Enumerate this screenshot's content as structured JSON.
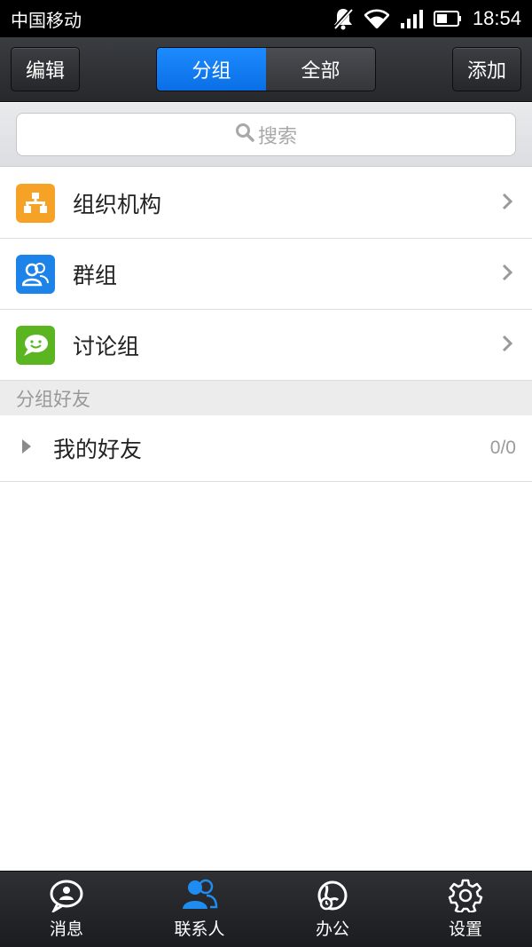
{
  "status_bar": {
    "carrier": "中国移动",
    "time": "18:54",
    "icons": [
      "notification-muted-icon",
      "wifi-icon",
      "signal-icon",
      "battery-icon"
    ]
  },
  "title_bar": {
    "edit_label": "编辑",
    "add_label": "添加",
    "tabs": [
      {
        "label": "分组",
        "active": true
      },
      {
        "label": "全部",
        "active": false
      }
    ]
  },
  "search": {
    "placeholder": "搜索"
  },
  "list": [
    {
      "label": "组织机构",
      "icon": "org-chart-icon",
      "color": "#f6a227"
    },
    {
      "label": "群组",
      "icon": "group-icon",
      "color": "#1e83e8"
    },
    {
      "label": "讨论组",
      "icon": "chat-bubble-icon",
      "color": "#5bb520"
    }
  ],
  "section": {
    "title": "分组好友"
  },
  "friends_group": {
    "label": "我的好友",
    "count": "0/0"
  },
  "bottom_nav": [
    {
      "label": "消息",
      "icon": "message-icon",
      "active": false
    },
    {
      "label": "联系人",
      "icon": "contacts-icon",
      "active": true
    },
    {
      "label": "办公",
      "icon": "office-icon",
      "active": false
    },
    {
      "label": "设置",
      "icon": "settings-icon",
      "active": false
    }
  ],
  "colors": {
    "accent": "#0a6fe6",
    "active_icon": "#1e8cf0"
  }
}
